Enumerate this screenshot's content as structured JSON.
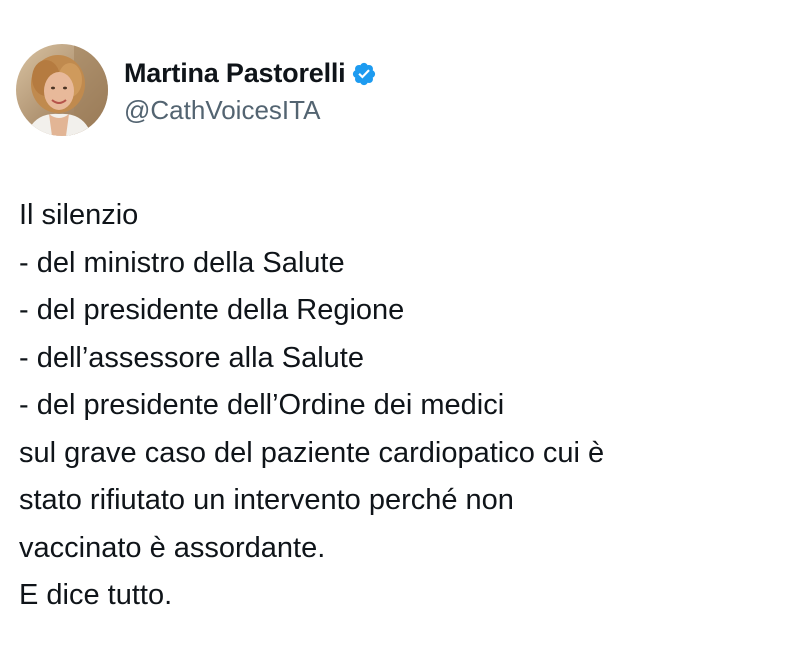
{
  "author": {
    "display_name": "Martina Pastorelli",
    "handle": "@CathVoicesITA",
    "verified_icon": "verified-badge-icon",
    "verified_color": "#1d9bf0"
  },
  "tweet": {
    "lines": [
      "Il silenzio",
      "- del ministro della Salute",
      "- del presidente della Regione",
      "- dell’assessore alla Salute",
      "- del presidente dell’Ordine dei medici",
      "sul grave caso del paziente cardiopatico cui è",
      "stato rifiutato un intervento perché non",
      "vaccinato è assordante.",
      "E dice tutto."
    ]
  },
  "colors": {
    "text_primary": "#0f1419",
    "text_secondary": "#536471",
    "background": "#ffffff"
  }
}
